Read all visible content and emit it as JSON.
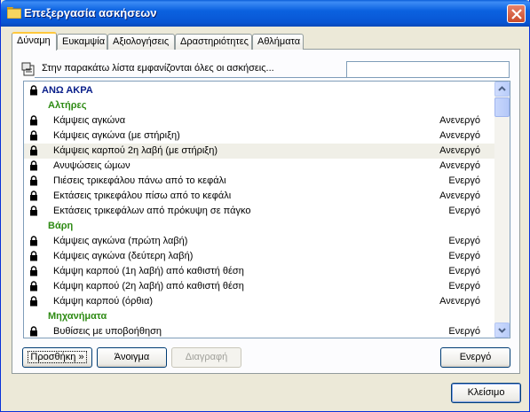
{
  "window": {
    "title": "Επεξεργασία ασκήσεων",
    "close_label": "×"
  },
  "tabs": [
    {
      "label": "Δύναμη",
      "active": true
    },
    {
      "label": "Ευκαμψία",
      "active": false
    },
    {
      "label": "Αξιολογήσεις",
      "active": false
    },
    {
      "label": "Δραστηριότητες",
      "active": false
    },
    {
      "label": "Αθλήματα",
      "active": false
    }
  ],
  "info": {
    "text": "Στην παρακάτω λίστα εμφανίζονται όλες οι ασκήσεις...",
    "search_value": ""
  },
  "list": {
    "rows": [
      {
        "kind": "group",
        "name": "ΑΝΩ ΑΚΡΑ",
        "status": "",
        "lock": true
      },
      {
        "kind": "sub",
        "name": "Αλτήρες",
        "status": "",
        "lock": false
      },
      {
        "kind": "item",
        "name": "Κάμψεις αγκώνα",
        "status": "Ανενεργό",
        "lock": true
      },
      {
        "kind": "item",
        "name": "Κάμψεις αγκώνα (με στήριξη)",
        "status": "Ανενεργό",
        "lock": true
      },
      {
        "kind": "item",
        "name": "Κάμψεις καρπού 2η λαβή (με στήριξη)",
        "status": "Ανενεργό",
        "lock": true,
        "selected": true
      },
      {
        "kind": "item",
        "name": "Ανυψώσεις ώμων",
        "status": "Ανενεργό",
        "lock": true
      },
      {
        "kind": "item",
        "name": "Πιέσεις τρικεφάλου πάνω από το κεφάλι",
        "status": "Ενεργό",
        "lock": true
      },
      {
        "kind": "item",
        "name": "Εκτάσεις τρικεφάλου πίσω από το κεφάλι",
        "status": "Ανενεργό",
        "lock": true
      },
      {
        "kind": "item",
        "name": "Εκτάσεις τρικεφάλων από πρόκυψη σε πάγκο",
        "status": "Ενεργό",
        "lock": true
      },
      {
        "kind": "sub",
        "name": "Βάρη",
        "status": "",
        "lock": false
      },
      {
        "kind": "item",
        "name": "Κάμψεις αγκώνα (πρώτη λαβή)",
        "status": "Ενεργό",
        "lock": true
      },
      {
        "kind": "item",
        "name": "Κάμψεις αγκώνα (δεύτερη λαβή)",
        "status": "Ενεργό",
        "lock": true
      },
      {
        "kind": "item",
        "name": "Κάμψη καρπού (1η λαβή) από καθιστή θέση",
        "status": "Ενεργό",
        "lock": true
      },
      {
        "kind": "item",
        "name": "Κάμψη καρπού (2η λαβή) από καθιστή θέση",
        "status": "Ενεργό",
        "lock": true
      },
      {
        "kind": "item",
        "name": "Κάμψη καρπού (όρθια)",
        "status": "Ανενεργό",
        "lock": true
      },
      {
        "kind": "sub",
        "name": "Μηχανήματα",
        "status": "",
        "lock": false
      },
      {
        "kind": "item",
        "name": "Βυθίσεις με υποβοήθηση",
        "status": "Ενεργό",
        "lock": true
      }
    ]
  },
  "buttons": {
    "add": "Προσθήκη »",
    "open": "Άνοιγμα",
    "delete": "Διαγραφή",
    "active": "Ενεργό",
    "close": "Κλείσιμο"
  }
}
